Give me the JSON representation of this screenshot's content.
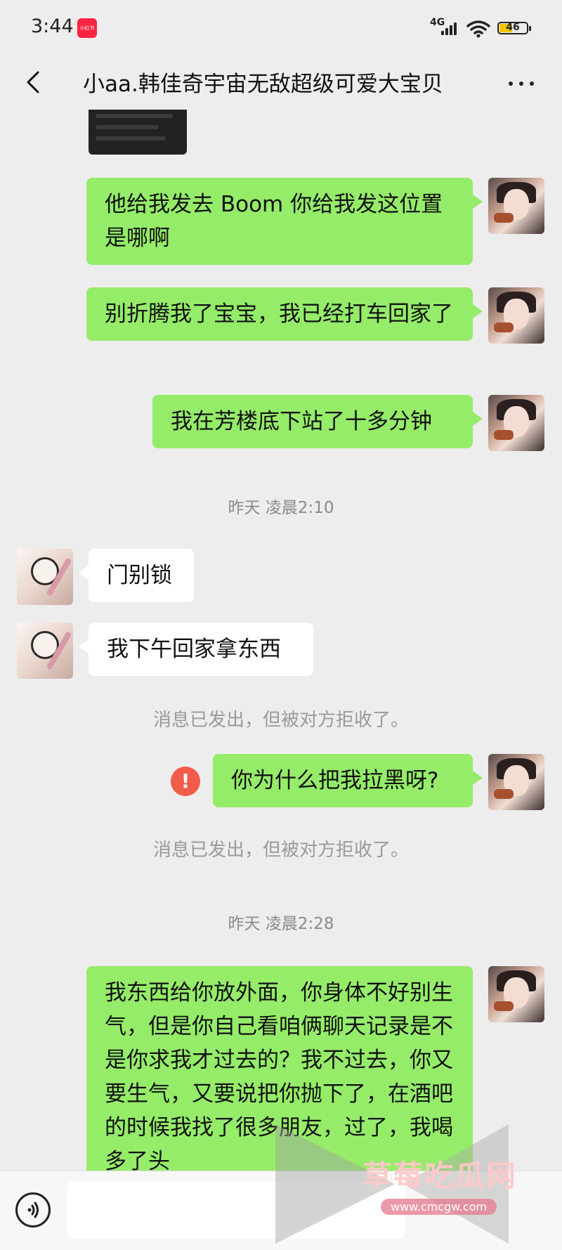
{
  "status_bar": {
    "time": "3:44",
    "app_badge": "小红书",
    "network": "4G",
    "battery": "46"
  },
  "header": {
    "title": "小aa.韩佳奇宇宙无敌超级可爱大宝贝"
  },
  "messages": [
    {
      "from": "me",
      "text": "他给我发去 Boom  你给我发这位置是哪啊"
    },
    {
      "from": "me",
      "text": "别折腾我了宝宝，我已经打车回家了"
    },
    {
      "from": "me",
      "text": "我在芳楼底下站了十多分钟"
    },
    {
      "type": "time",
      "text": "昨天 凌晨2:10"
    },
    {
      "from": "them",
      "text": "门别锁"
    },
    {
      "from": "them",
      "text": "我下午回家拿东西"
    },
    {
      "type": "system",
      "text": "消息已发出，但被对方拒收了。"
    },
    {
      "from": "me",
      "text": "你为什么把我拉黑呀?",
      "failed": true
    },
    {
      "type": "system",
      "text": "消息已发出，但被对方拒收了。"
    },
    {
      "type": "time",
      "text": "昨天 凌晨2:28"
    },
    {
      "from": "me",
      "text": "我东西给你放外面，你身体不好别生气，但是你自己看咱俩聊天记录是不是你求我才过去的？我不过去，你又要生气，又要说把你抛下了，在酒吧的时候我找了很多朋友，过了，我喝多了头"
    }
  ],
  "error_icon": "!",
  "input_bar": {
    "value": ""
  },
  "watermark": {
    "title": "草莓吃瓜网",
    "url": "www.cmcgw.com"
  },
  "colors": {
    "my_bubble": "#95ec69",
    "their_bubble": "#ffffff",
    "background": "#ededed",
    "error": "#f25b4a"
  }
}
